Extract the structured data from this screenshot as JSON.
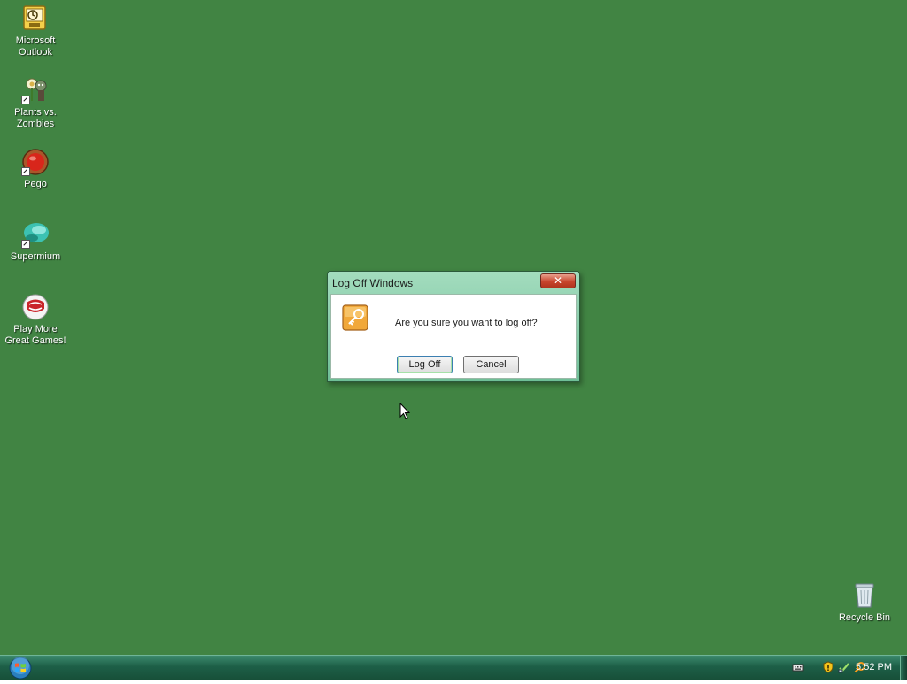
{
  "desktop": {
    "background_color": "#418443",
    "icons": [
      {
        "label": "Microsoft\nOutlook",
        "icon": "outlook-icon"
      },
      {
        "label": "Plants vs.\nZombies",
        "icon": "plants-vs-zombies-icon"
      },
      {
        "label": "Pego",
        "icon": "pego-icon"
      },
      {
        "label": "Supermium",
        "icon": "supermium-icon"
      },
      {
        "label": "Play More\nGreat Games!",
        "icon": "popcap-games-icon"
      },
      {
        "label": "Recycle Bin",
        "icon": "recycle-bin-icon"
      }
    ]
  },
  "dialog": {
    "title": "Log Off Windows",
    "close_glyph": "✕",
    "message": "Are you sure you want to log off?",
    "confirm_label": "Log Off",
    "cancel_label": "Cancel",
    "icon": "key-icon"
  },
  "taskbar": {
    "start_icon": "windows-start-orb-icon",
    "tray_icons": [
      "keyboard-icon",
      "security-shield-icon",
      "network-icon",
      "search-icon"
    ],
    "clock": "5:52 PM"
  }
}
